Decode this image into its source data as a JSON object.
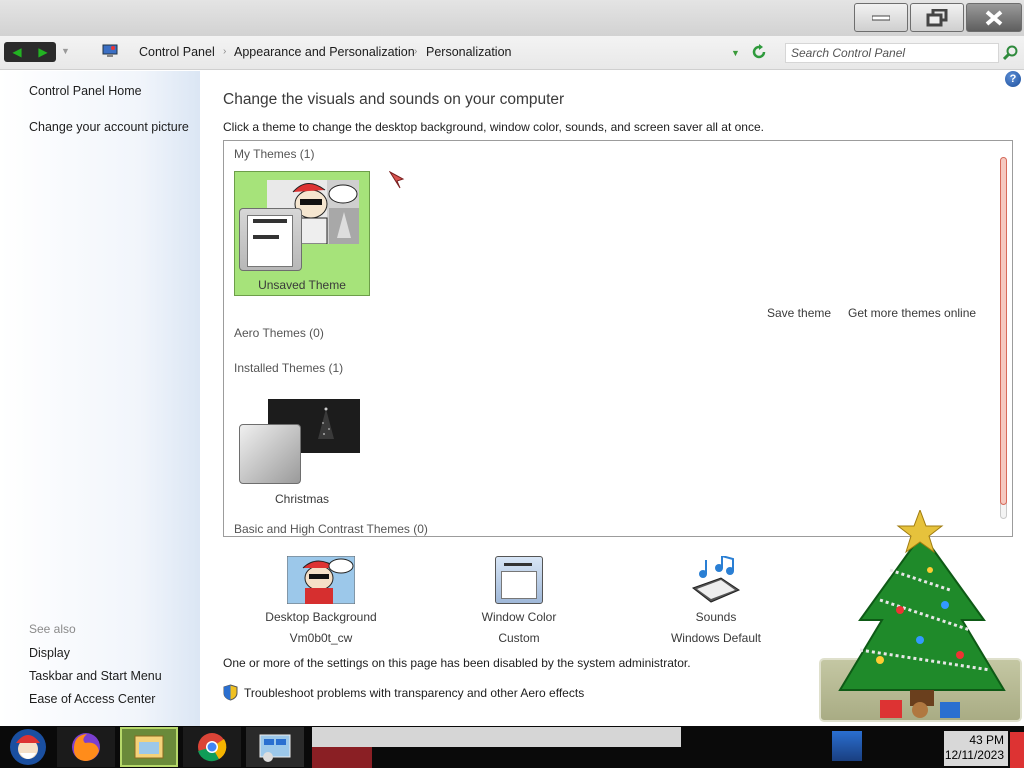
{
  "addressbar": {
    "breadcrumbs": [
      "Control Panel",
      "Appearance and Personalization",
      "Personalization"
    ],
    "search_placeholder": "Search Control Panel"
  },
  "sidebar": {
    "links": [
      "Control Panel Home",
      "Change your account picture"
    ],
    "see_also_label": "See also",
    "see_also_links": [
      "Display",
      "Taskbar and Start Menu",
      "Ease of Access Center"
    ]
  },
  "main": {
    "title": "Change the visuals and sounds on your computer",
    "subtitle": "Click a theme to change the desktop background, window color, sounds, and screen saver all at once.",
    "groups": {
      "my_themes": "My Themes (1)",
      "aero_themes": "Aero Themes (0)",
      "installed_themes": "Installed Themes (1)",
      "basic_themes": "Basic and High Contrast Themes (0)"
    },
    "themes": {
      "unsaved": "Unsaved Theme",
      "christmas": "Christmas"
    },
    "save_theme": "Save theme",
    "get_more_themes": "Get more themes online",
    "bottom": {
      "desktop_background": {
        "label": "Desktop Background",
        "value": "Vm0b0t_cw"
      },
      "window_color": {
        "label": "Window Color",
        "value": "Custom"
      },
      "sounds": {
        "label": "Sounds",
        "value": "Windows Default"
      }
    },
    "notice": "One or more of the settings on this page has been disabled by the system administrator.",
    "troubleshoot": "Troubleshoot problems with transparency and other Aero effects"
  },
  "taskbar": {
    "time": "43 PM",
    "date": "12/11/2023"
  },
  "colors": {
    "selected_tile": "#a6e37a",
    "nav_arrows": "#22b322",
    "scrollbar": "#d86a5a"
  },
  "icons": [
    "minimize-icon",
    "restore-icon",
    "close-icon",
    "back-arrow-icon",
    "forward-arrow-icon",
    "control-panel-icon",
    "refresh-icon",
    "search-icon",
    "help-icon",
    "shield-icon",
    "start-icon",
    "firefox-icon",
    "explorer-icon",
    "chrome-icon",
    "control-panel-taskbar-icon"
  ]
}
